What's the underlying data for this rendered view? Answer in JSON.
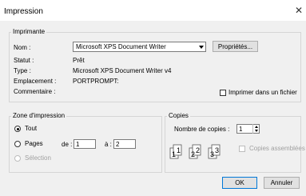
{
  "window": {
    "title": "Impression",
    "close_glyph": "✕"
  },
  "printer_group": {
    "legend": "Imprimante",
    "name_label": "Nom :",
    "selected_printer": "Microsoft XPS Document Writer",
    "properties_button": "Propriétés...",
    "status_label": "Statut :",
    "status_value": "Prêt",
    "type_label": "Type :",
    "type_value": "Microsoft XPS Document Writer v4",
    "location_label": "Emplacement :",
    "location_value": "PORTPROMPT:",
    "comment_label": "Commentaire :",
    "print_to_file_label": "Imprimer dans un fichier",
    "print_to_file_checked": false
  },
  "range_group": {
    "legend": "Zone d'impression",
    "all_label": "Tout",
    "pages_label": "Pages",
    "from_label": "de :",
    "from_value": "1",
    "to_label": "à :",
    "to_value": "2",
    "selection_label": "Sélection",
    "selected_option": "Tout"
  },
  "copies_group": {
    "legend": "Copies",
    "count_label": "Nombre de copies :",
    "count_value": "1",
    "collate_label": "Copies assemblées",
    "collate_checked": false,
    "collate_icon_labels": [
      "1",
      "1",
      "2",
      "2",
      "3",
      "3"
    ]
  },
  "buttons": {
    "ok": "OK",
    "cancel": "Annuler"
  },
  "icons": {
    "close": "close-icon",
    "dropdown": "chevron-down-icon",
    "spin": "spin-arrows-icon",
    "collate": "collate-pages-icon"
  }
}
